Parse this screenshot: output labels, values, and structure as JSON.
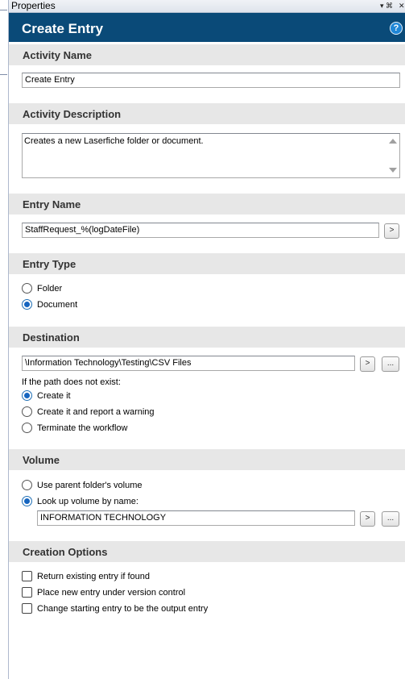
{
  "panel": {
    "title": "Properties",
    "pin_glyph": "▾ ⌘",
    "close_glyph": "✕"
  },
  "header": {
    "title": "Create Entry",
    "help_label": "?"
  },
  "activity_name": {
    "heading": "Activity Name",
    "value": "Create Entry"
  },
  "activity_description": {
    "heading": "Activity Description",
    "value": "Creates a new Laserfiche folder or document."
  },
  "entry_name": {
    "heading": "Entry Name",
    "value": "StaffRequest_%(logDateFile)",
    "token_button": ">"
  },
  "entry_type": {
    "heading": "Entry Type",
    "options": [
      "Folder",
      "Document"
    ],
    "selected": "Document"
  },
  "destination": {
    "heading": "Destination",
    "path": "\\Information Technology\\Testing\\CSV Files",
    "token_button": ">",
    "browse_button": "...",
    "if_not_exist_label": "If the path does not exist:",
    "options": [
      "Create it",
      "Create it and report a warning",
      "Terminate the workflow"
    ],
    "selected": "Create it"
  },
  "volume": {
    "heading": "Volume",
    "options": [
      "Use parent folder's volume",
      "Look up volume by name:"
    ],
    "selected": "Look up volume by name:",
    "volume_name": "INFORMATION TECHNOLOGY",
    "token_button": ">",
    "browse_button": "..."
  },
  "creation_options": {
    "heading": "Creation Options",
    "options": [
      {
        "label": "Return existing entry if found",
        "checked": false
      },
      {
        "label": "Place new entry under version control",
        "checked": false
      },
      {
        "label": "Change starting entry to be the output entry",
        "checked": false
      }
    ]
  },
  "colors": {
    "header_bg": "#0a4a78",
    "section_bg": "#e7e7e7",
    "radio_selected": "#1565c0"
  }
}
